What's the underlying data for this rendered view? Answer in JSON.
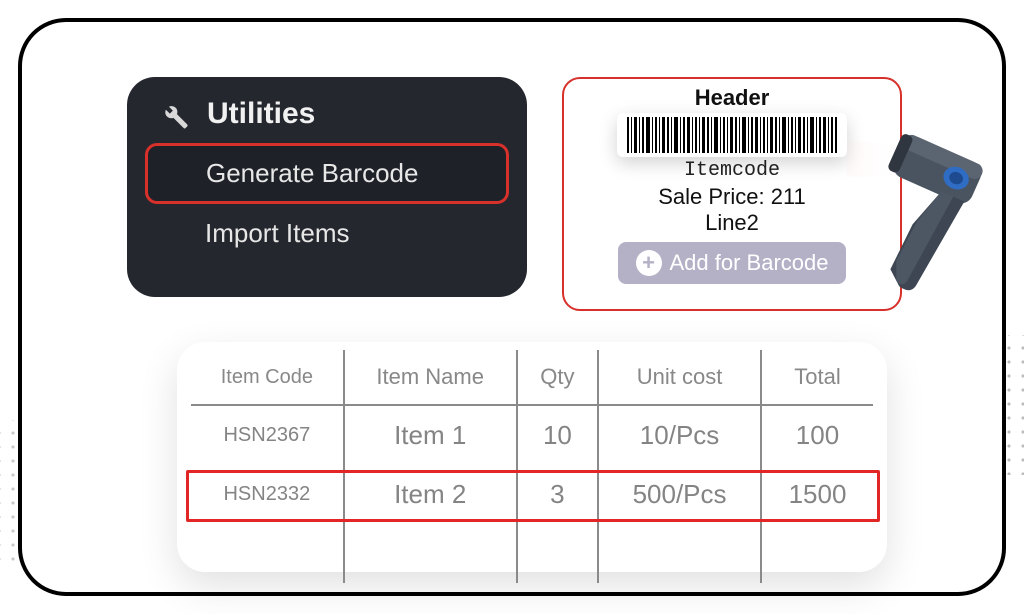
{
  "utilities": {
    "title": "Utilities",
    "items": [
      {
        "label": "Generate Barcode",
        "selected": true
      },
      {
        "label": "Import Items",
        "selected": false
      }
    ]
  },
  "barcode_card": {
    "header": "Header",
    "itemcode": "Itemcode",
    "sale_price_label": "Sale Price:",
    "sale_price_value": "211",
    "line2": "Line2",
    "add_button": "Add for Barcode"
  },
  "items_table": {
    "headers": [
      "Item Code",
      "Item Name",
      "Qty",
      "Unit cost",
      "Total"
    ],
    "rows": [
      {
        "code": "HSN2367",
        "name": "Item 1",
        "qty": "10",
        "unit_cost": "10/Pcs",
        "total": "100",
        "highlighted": false
      },
      {
        "code": "HSN2332",
        "name": "Item 2",
        "qty": "3",
        "unit_cost": "500/Pcs",
        "total": "1500",
        "highlighted": true
      }
    ]
  }
}
